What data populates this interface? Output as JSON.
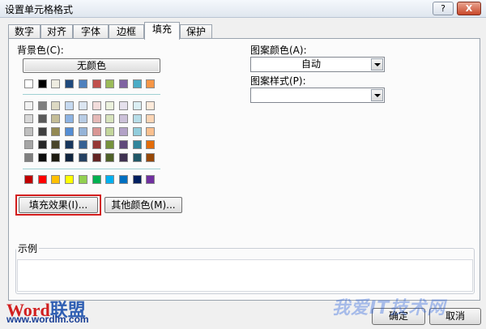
{
  "window": {
    "title": "设置单元格格式",
    "help_label": "?",
    "close_label": "X"
  },
  "tabs": [
    {
      "label": "数字"
    },
    {
      "label": "对齐"
    },
    {
      "label": "字体"
    },
    {
      "label": "边框"
    },
    {
      "label": "填充",
      "active": true
    },
    {
      "label": "保护"
    }
  ],
  "fill": {
    "background_color_label": "背景色(C):",
    "no_color_button": "无颜色",
    "fill_effects_button": "填充效果(I)...",
    "more_colors_button": "其他颜色(M)...",
    "theme_row": [
      "#ffffff",
      "#000000",
      "#eeece1",
      "#1f497d",
      "#4f81bd",
      "#c0504d",
      "#9bbb59",
      "#8064a2",
      "#4bacc6",
      "#f79646"
    ],
    "tints": [
      [
        "#f2f2f2",
        "#7f7f7f",
        "#ddd9c3",
        "#c6d9f0",
        "#dbe5f1",
        "#f2dcdb",
        "#ebf1dd",
        "#e5e0ec",
        "#dbeef3",
        "#fdeada"
      ],
      [
        "#d8d8d8",
        "#595959",
        "#c4bd97",
        "#8db3e2",
        "#b8cce4",
        "#e5b9b7",
        "#d7e3bc",
        "#ccc1d9",
        "#b7dde8",
        "#fbd5b5"
      ],
      [
        "#bfbfbf",
        "#3f3f3f",
        "#938953",
        "#548dd4",
        "#95b3d7",
        "#d99694",
        "#c3d69b",
        "#b2a2c7",
        "#92cddc",
        "#fac08f"
      ],
      [
        "#a5a5a5",
        "#262626",
        "#494429",
        "#17365d",
        "#366092",
        "#953734",
        "#76923c",
        "#5f497a",
        "#31859b",
        "#e36c09"
      ],
      [
        "#7f7f7f",
        "#0c0c0c",
        "#1d1b10",
        "#0f243e",
        "#244061",
        "#632423",
        "#4f6128",
        "#3f3151",
        "#205867",
        "#974806"
      ]
    ],
    "standard_row": [
      "#c00000",
      "#ff0000",
      "#ffc000",
      "#ffff00",
      "#92d050",
      "#00b050",
      "#00b0f0",
      "#0070c0",
      "#002060",
      "#7030a0"
    ]
  },
  "pattern": {
    "color_label": "图案颜色(A):",
    "color_value": "自动",
    "style_label": "图案样式(P):",
    "style_value": ""
  },
  "sample": {
    "label": "示例"
  },
  "footer": {
    "ok_label": "确定",
    "cancel_label": "取消"
  },
  "watermark": {
    "logo_word": "Word",
    "logo_union": "联盟",
    "url": "www.wordlm.com",
    "site": "我爱IT技术网"
  }
}
